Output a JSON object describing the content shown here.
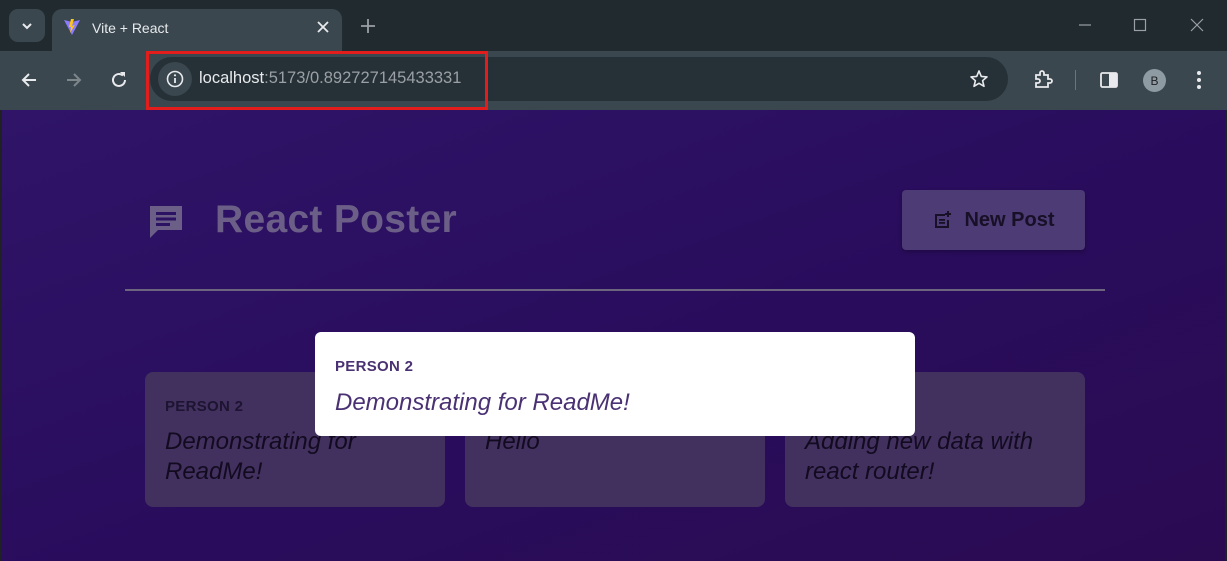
{
  "browser": {
    "tab_title": "Vite + React",
    "url_host": "localhost",
    "url_rest": ":5173/0.892727145433331",
    "profile_initial": "B",
    "icons": [
      "chevron-down-icon",
      "vite-favicon-icon",
      "close-icon",
      "plus-icon",
      "minimize-icon",
      "maximize-icon",
      "close-window-icon",
      "back-icon",
      "forward-icon",
      "reload-icon",
      "info-icon",
      "star-icon",
      "extensions-icon",
      "sidepanel-icon",
      "more-icon"
    ]
  },
  "app": {
    "title": "React Poster",
    "new_post_label": "New Post",
    "posts": [
      {
        "author": "PERSON 2",
        "body": "Demonstrating for ReadMe!"
      },
      {
        "author": "",
        "body": "Hello"
      },
      {
        "author": "",
        "body": "Adding new data with react router!"
      }
    ],
    "modal": {
      "author": "PERSON 2",
      "body": "Demonstrating for ReadMe!"
    }
  },
  "colors": {
    "highlight": "#e31c1c",
    "page_bg": "#2f1468",
    "accent_text": "#4a3173"
  }
}
